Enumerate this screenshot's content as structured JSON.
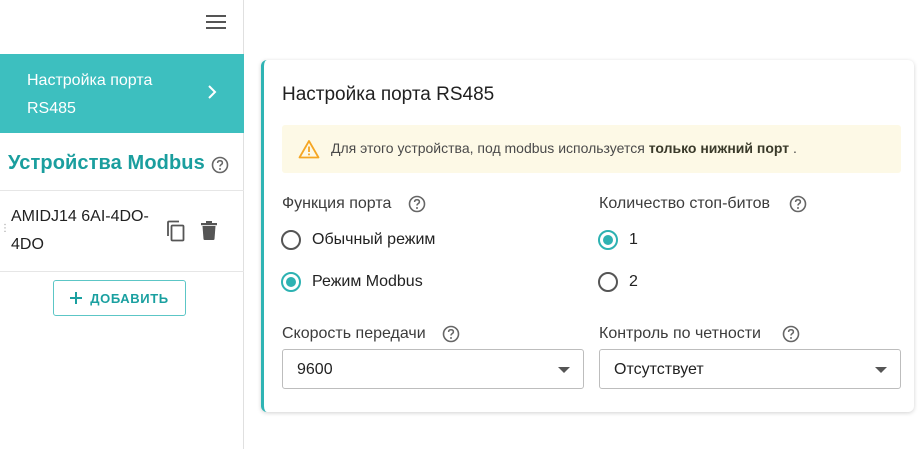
{
  "sidebar": {
    "active_item": {
      "label": "Настройка порта RS485",
      "icon": "chevron-right-icon"
    },
    "section_title": "Устройства Modbus",
    "devices": [
      {
        "name": "AMIDJ14 6AI-4DO-4DO"
      }
    ],
    "add_label": "ДОБАВИТЬ"
  },
  "card": {
    "title": "Настройка порта RS485",
    "alert": {
      "text": "Для этого устройства, под modbus используется ",
      "bold": "только нижний порт",
      "suffix": " ."
    },
    "port_function": {
      "label": "Функция порта",
      "options": [
        {
          "label": "Обычный режим",
          "checked": false
        },
        {
          "label": "Режим Modbus",
          "checked": true
        }
      ]
    },
    "stop_bits": {
      "label": "Количество стоп-битов",
      "options": [
        {
          "label": "1",
          "checked": true
        },
        {
          "label": "2",
          "checked": false
        }
      ]
    },
    "baud_rate": {
      "label": "Скорость передачи",
      "value": "9600"
    },
    "parity": {
      "label": "Контроль по четности",
      "value": "Отсутствует"
    }
  },
  "colors": {
    "accent": "#3dbfbf",
    "accent_dark": "#1a9e9e",
    "alert_bg": "#fdf9e6",
    "warning": "#f5a623"
  }
}
